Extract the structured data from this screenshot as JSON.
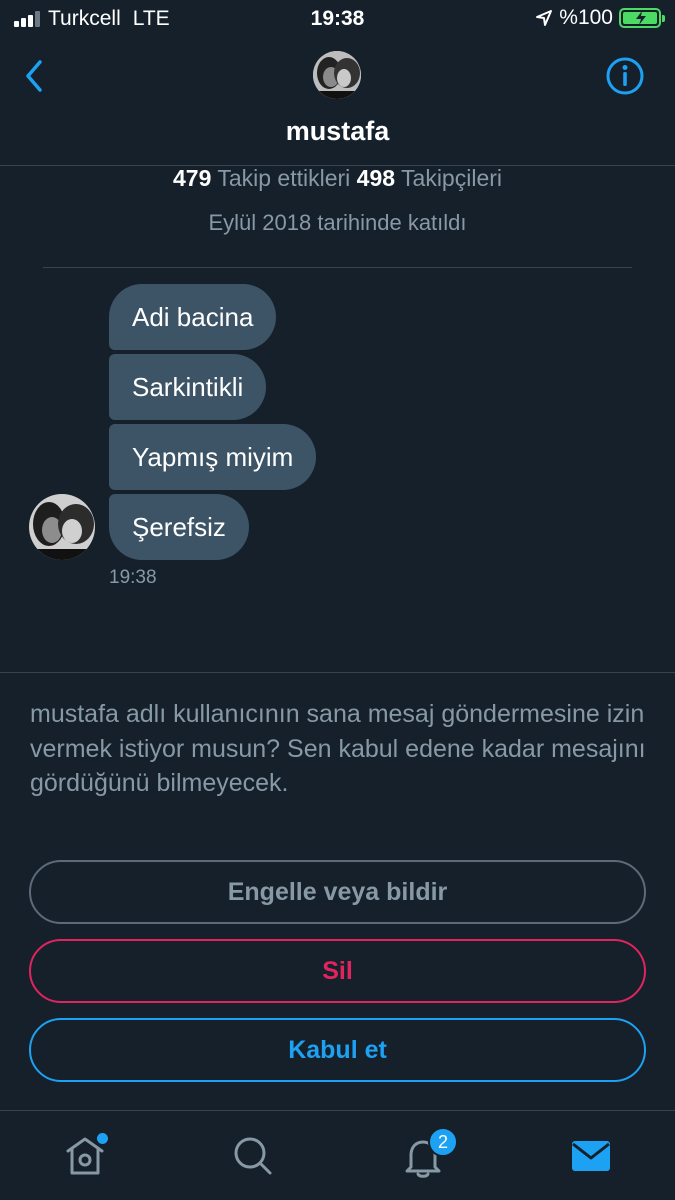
{
  "status_bar": {
    "carrier": "Turkcell",
    "network": "LTE",
    "time": "19:38",
    "battery": "%100",
    "battery_color": "#4cd964"
  },
  "header": {
    "name": "mustafa",
    "back_icon": "chevron-left-icon",
    "info_icon": "info-icon"
  },
  "profile": {
    "following_count": "479",
    "following_label": "Takip ettikleri",
    "followers_count": "498",
    "followers_label": "Takipçileri",
    "joined": "Eylül 2018 tarihinde katıldı"
  },
  "messages": [
    {
      "text": "Adi bacina"
    },
    {
      "text": "Sarkintikli"
    },
    {
      "text": "Yapmış miyim"
    },
    {
      "text": "Şerefsiz"
    }
  ],
  "message_time": "19:38",
  "request": {
    "text": "mustafa adlı kullanıcının sana mesaj göndermesine izin vermek istiyor musun? Sen kabul edene kadar mesajını gördüğünü bilmeyecek.",
    "block_label": "Engelle veya bildir",
    "delete_label": "Sil",
    "accept_label": "Kabul et"
  },
  "tabbar": {
    "notification_count": "2",
    "accent_color": "#1da1f2"
  },
  "colors": {
    "background": "#15202b",
    "bubble": "#3d5466",
    "muted": "#8899a6",
    "danger": "#e0245e",
    "accent": "#1da1f2"
  }
}
